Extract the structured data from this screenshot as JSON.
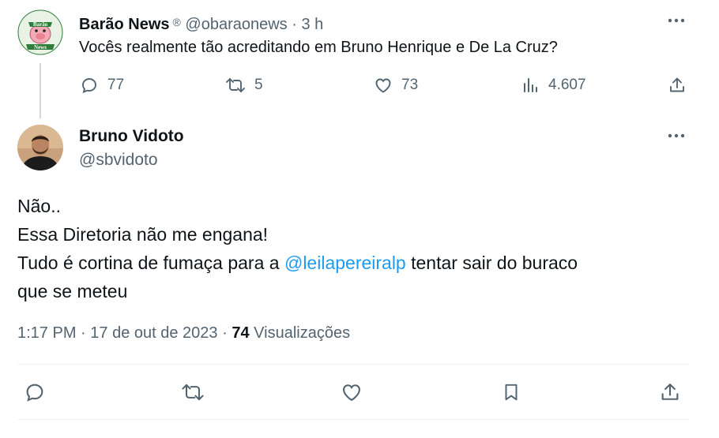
{
  "parent_tweet": {
    "author_name": "Barão News",
    "badge": "®",
    "handle": "@obaraonews",
    "separator": "·",
    "time": "3 h",
    "text": "Vocês realmente tão acreditando em Bruno Henrique e De La Cruz?",
    "avatar_text_top": "Barão",
    "avatar_text_bottom": "News",
    "stats": {
      "replies": "77",
      "retweets": "5",
      "likes": "73",
      "views": "4.607"
    }
  },
  "reply_tweet": {
    "author_name": "Bruno Vidoto",
    "handle": "@sbvidoto",
    "body_line1": "Não..",
    "body_line2": "Essa Diretoria não me engana!",
    "body_line3_pre": "Tudo é cortina de fumaça para a ",
    "mention": "@leilapereiralp",
    "body_line3_post": " tentar sair do buraco",
    "body_line4": "que se meteu",
    "time": "1:17 PM",
    "meta_sep": "·",
    "date": "17 de out de 2023",
    "views_count": "74",
    "views_label": "Visualizações"
  },
  "colors": {
    "text": "#0f1419",
    "muted": "#536471",
    "link": "#1d9bf0",
    "thread_line": "#cfd9de",
    "divider": "#eff3f4",
    "avatar_green": "#2f7d3a"
  },
  "icons": [
    "reply-icon",
    "retweet-icon",
    "like-icon",
    "views-icon",
    "share-icon",
    "bookmark-icon",
    "more-icon"
  ]
}
